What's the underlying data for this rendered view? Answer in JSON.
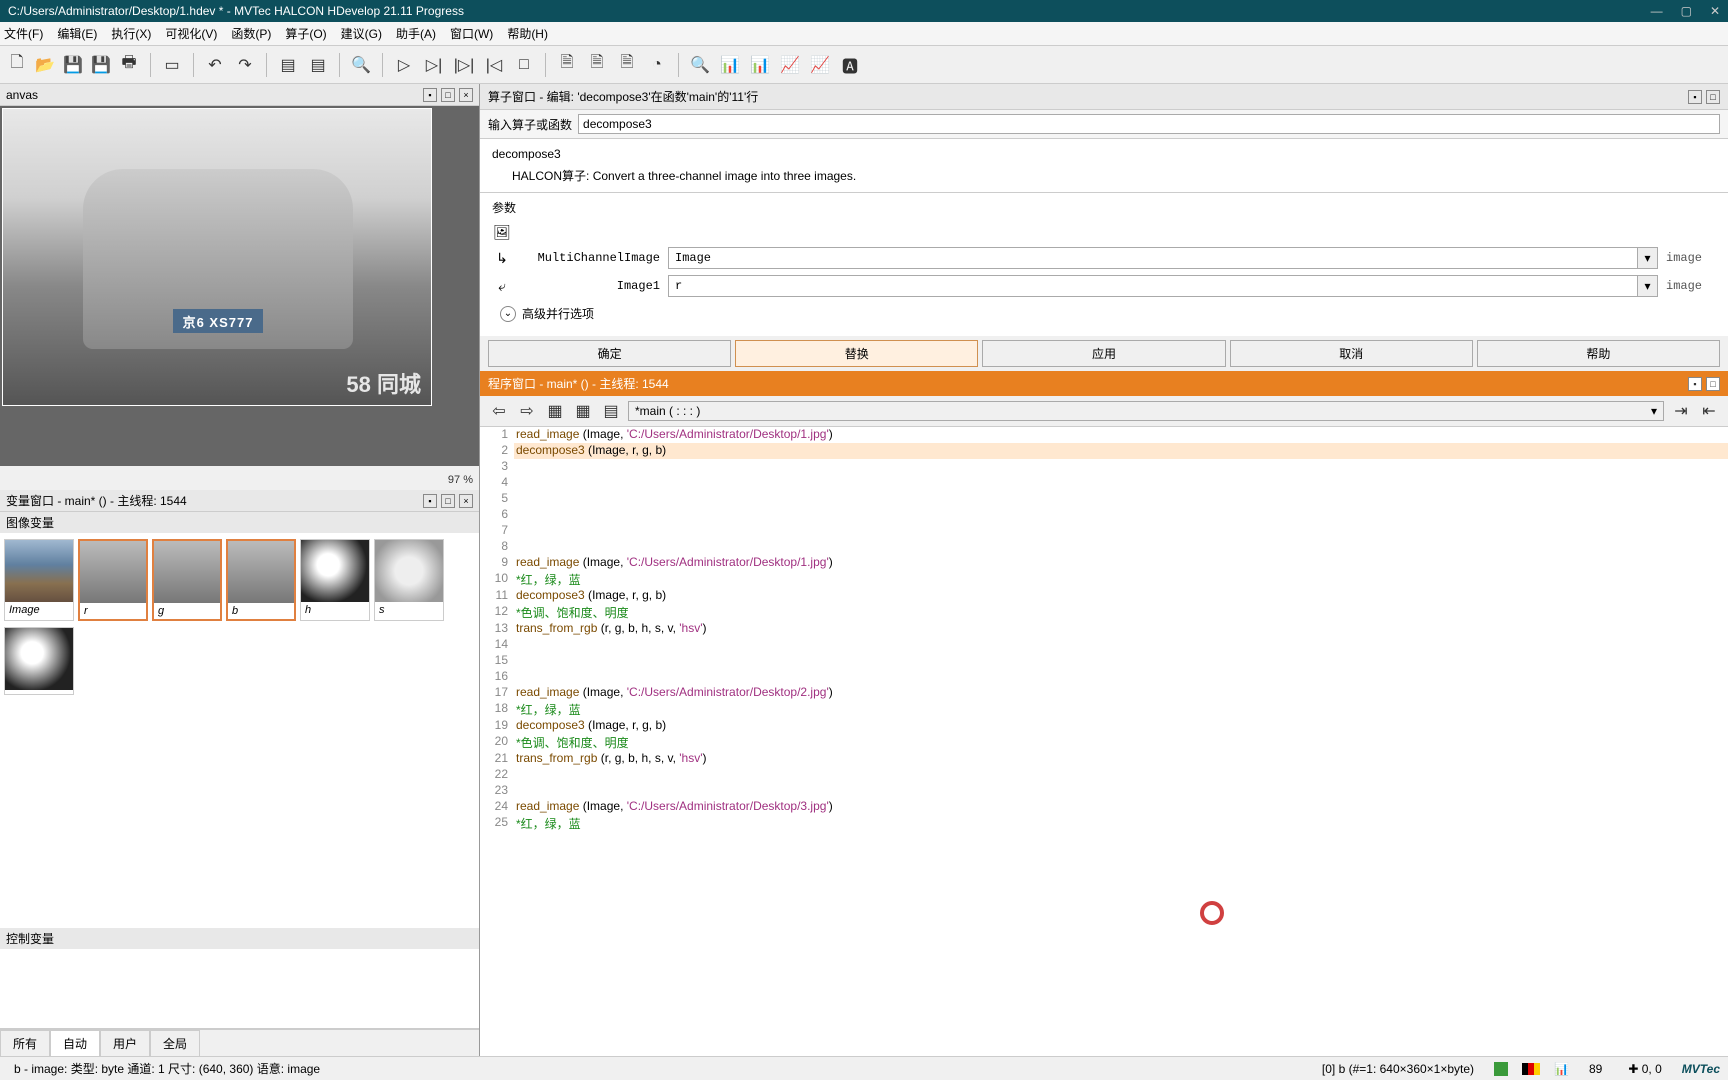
{
  "title": "C:/Users/Administrator/Desktop/1.hdev * - MVTec HALCON HDevelop 21.11 Progress",
  "menu": {
    "file": "文件(F)",
    "edit": "编辑(E)",
    "exec": "执行(X)",
    "vis": "可视化(V)",
    "func": "函数(P)",
    "op": "算子(O)",
    "sugg": "建议(G)",
    "asst": "助手(A)",
    "win": "窗口(W)",
    "help": "帮助(H)"
  },
  "canvas": {
    "title": "anvas",
    "zoom": "97 %",
    "plate": "京6 XS777",
    "watermark": "58 同城"
  },
  "varwin": {
    "title": "变量窗口 - main* () - 主线程: 1544",
    "section": "图像变量",
    "section2": "控制变量",
    "thumbs": [
      {
        "name": "Image",
        "cls": "color"
      },
      {
        "name": "r",
        "cls": "",
        "sel": true
      },
      {
        "name": "g",
        "cls": "",
        "sel": true
      },
      {
        "name": "b",
        "cls": "",
        "sel": true
      },
      {
        "name": "h",
        "cls": "bw1"
      },
      {
        "name": "s",
        "cls": "bw2"
      }
    ],
    "thumbs2": [
      {
        "name": "",
        "cls": "bw1"
      }
    ],
    "tabs": {
      "all": "所有",
      "auto": "自动",
      "user": "用户",
      "global": "全局"
    }
  },
  "operator": {
    "header": "算子窗口 - 编辑:  'decompose3'在函数'main'的'11'行",
    "search_label": "输入算子或函数",
    "search_value": "decompose3",
    "name": "decompose3",
    "desc_label": "HALCON算子:",
    "desc": "Convert a three-channel image into three images.",
    "params_label": "参数",
    "param1": {
      "name": "MultiChannelImage",
      "value": "Image",
      "type": "image"
    },
    "param2": {
      "name": "Image1",
      "value": "r",
      "type": "image"
    },
    "adv": "高级并行选项",
    "buttons": {
      "ok": "确定",
      "replace": "替换",
      "apply": "应用",
      "cancel": "取消",
      "help": "帮助"
    }
  },
  "program": {
    "header": "程序窗口 - main* () - 主线程: 1544",
    "fn": "*main ( : : : )",
    "lines": [
      {
        "n": 1,
        "t": "read_image (Image, 'C:/Users/Administrator/Desktop/1.jpg')",
        "parts": [
          [
            "op",
            "read_image"
          ],
          [
            "p",
            " ("
          ],
          [
            "v",
            "Image"
          ],
          [
            "p",
            ", "
          ],
          [
            "str",
            "'C:/Users/Administrator/Desktop/1.jpg'"
          ],
          [
            "p",
            ")"
          ]
        ]
      },
      {
        "n": 2,
        "t": "decompose3 (Image, r, g, b)",
        "hl": true,
        "parts": [
          [
            "op",
            "decompose3"
          ],
          [
            "p",
            " ("
          ],
          [
            "v",
            "Image"
          ],
          [
            "p",
            ", "
          ],
          [
            "v",
            "r"
          ],
          [
            "p",
            ", "
          ],
          [
            "v",
            "g"
          ],
          [
            "p",
            ", "
          ],
          [
            "v",
            "b"
          ],
          [
            "p",
            ")"
          ]
        ]
      },
      {
        "n": 3,
        "t": ""
      },
      {
        "n": 4,
        "t": ""
      },
      {
        "n": 5,
        "t": ""
      },
      {
        "n": 6,
        "t": ""
      },
      {
        "n": 7,
        "t": ""
      },
      {
        "n": 8,
        "t": ""
      },
      {
        "n": 9,
        "ptr": true,
        "t": "read_image (Image, 'C:/Users/Administrator/Desktop/1.jpg')",
        "parts": [
          [
            "op",
            "read_image"
          ],
          [
            "p",
            " ("
          ],
          [
            "v",
            "Image"
          ],
          [
            "p",
            ", "
          ],
          [
            "str",
            "'C:/Users/Administrator/Desktop/1.jpg'"
          ],
          [
            "p",
            ")"
          ]
        ]
      },
      {
        "n": 10,
        "t": "*红，绿，蓝",
        "cmt": true
      },
      {
        "n": 11,
        "t": "decompose3 (Image, r, g, b)",
        "parts": [
          [
            "op",
            "decompose3"
          ],
          [
            "p",
            " ("
          ],
          [
            "v",
            "Image"
          ],
          [
            "p",
            ", "
          ],
          [
            "v",
            "r"
          ],
          [
            "p",
            ", "
          ],
          [
            "v",
            "g"
          ],
          [
            "p",
            ", "
          ],
          [
            "v",
            "b"
          ],
          [
            "p",
            ")"
          ]
        ]
      },
      {
        "n": 12,
        "t": "*色调、饱和度、明度",
        "cmt": true
      },
      {
        "n": 13,
        "t": "trans_from_rgb (r, g, b, h, s, v, 'hsv')",
        "parts": [
          [
            "op",
            "trans_from_rgb"
          ],
          [
            "p",
            " ("
          ],
          [
            "v",
            "r"
          ],
          [
            "p",
            ", "
          ],
          [
            "v",
            "g"
          ],
          [
            "p",
            ", "
          ],
          [
            "v",
            "b"
          ],
          [
            "p",
            ", "
          ],
          [
            "v",
            "h"
          ],
          [
            "p",
            ", "
          ],
          [
            "v",
            "s"
          ],
          [
            "p",
            ", "
          ],
          [
            "v",
            "v"
          ],
          [
            "p",
            ", "
          ],
          [
            "str",
            "'hsv'"
          ],
          [
            "p",
            ")"
          ]
        ]
      },
      {
        "n": 14,
        "t": ""
      },
      {
        "n": 15,
        "t": ""
      },
      {
        "n": 16,
        "t": ""
      },
      {
        "n": 17,
        "t": "read_image (Image, 'C:/Users/Administrator/Desktop/2.jpg')",
        "parts": [
          [
            "op",
            "read_image"
          ],
          [
            "p",
            " ("
          ],
          [
            "v",
            "Image"
          ],
          [
            "p",
            ", "
          ],
          [
            "str",
            "'C:/Users/Administrator/Desktop/2.jpg'"
          ],
          [
            "p",
            ")"
          ]
        ]
      },
      {
        "n": 18,
        "t": "*红，绿，蓝",
        "cmt": true
      },
      {
        "n": 19,
        "t": "decompose3 (Image, r, g, b)",
        "parts": [
          [
            "op",
            "decompose3"
          ],
          [
            "p",
            " ("
          ],
          [
            "v",
            "Image"
          ],
          [
            "p",
            ", "
          ],
          [
            "v",
            "r"
          ],
          [
            "p",
            ", "
          ],
          [
            "v",
            "g"
          ],
          [
            "p",
            ", "
          ],
          [
            "v",
            "b"
          ],
          [
            "p",
            ")"
          ]
        ]
      },
      {
        "n": 20,
        "t": "*色调、饱和度、明度",
        "cmt": true
      },
      {
        "n": 21,
        "t": "trans_from_rgb (r, g, b, h, s, v, 'hsv')",
        "parts": [
          [
            "op",
            "trans_from_rgb"
          ],
          [
            "p",
            " ("
          ],
          [
            "v",
            "r"
          ],
          [
            "p",
            ", "
          ],
          [
            "v",
            "g"
          ],
          [
            "p",
            ", "
          ],
          [
            "v",
            "b"
          ],
          [
            "p",
            ", "
          ],
          [
            "v",
            "h"
          ],
          [
            "p",
            ", "
          ],
          [
            "v",
            "s"
          ],
          [
            "p",
            ", "
          ],
          [
            "v",
            "v"
          ],
          [
            "p",
            ", "
          ],
          [
            "str",
            "'hsv'"
          ],
          [
            "p",
            ")"
          ]
        ]
      },
      {
        "n": 22,
        "t": ""
      },
      {
        "n": 23,
        "t": ""
      },
      {
        "n": 24,
        "t": "read_image (Image, 'C:/Users/Administrator/Desktop/3.jpg')",
        "parts": [
          [
            "op",
            "read_image"
          ],
          [
            "p",
            " ("
          ],
          [
            "v",
            "Image"
          ],
          [
            "p",
            ", "
          ],
          [
            "str",
            "'C:/Users/Administrator/Desktop/3.jpg'"
          ],
          [
            "p",
            ")"
          ]
        ]
      },
      {
        "n": 25,
        "t": "*红，绿，蓝",
        "cmt": true
      }
    ]
  },
  "status": {
    "left": "b - image: 类型: byte 通道: 1 尺寸: (640, 360) 语意: image",
    "mid": "[0] b (#=1: 640×360×1×byte)",
    "prog": "89",
    "coords": "✚ 0, 0",
    "brand": "MVTec"
  }
}
